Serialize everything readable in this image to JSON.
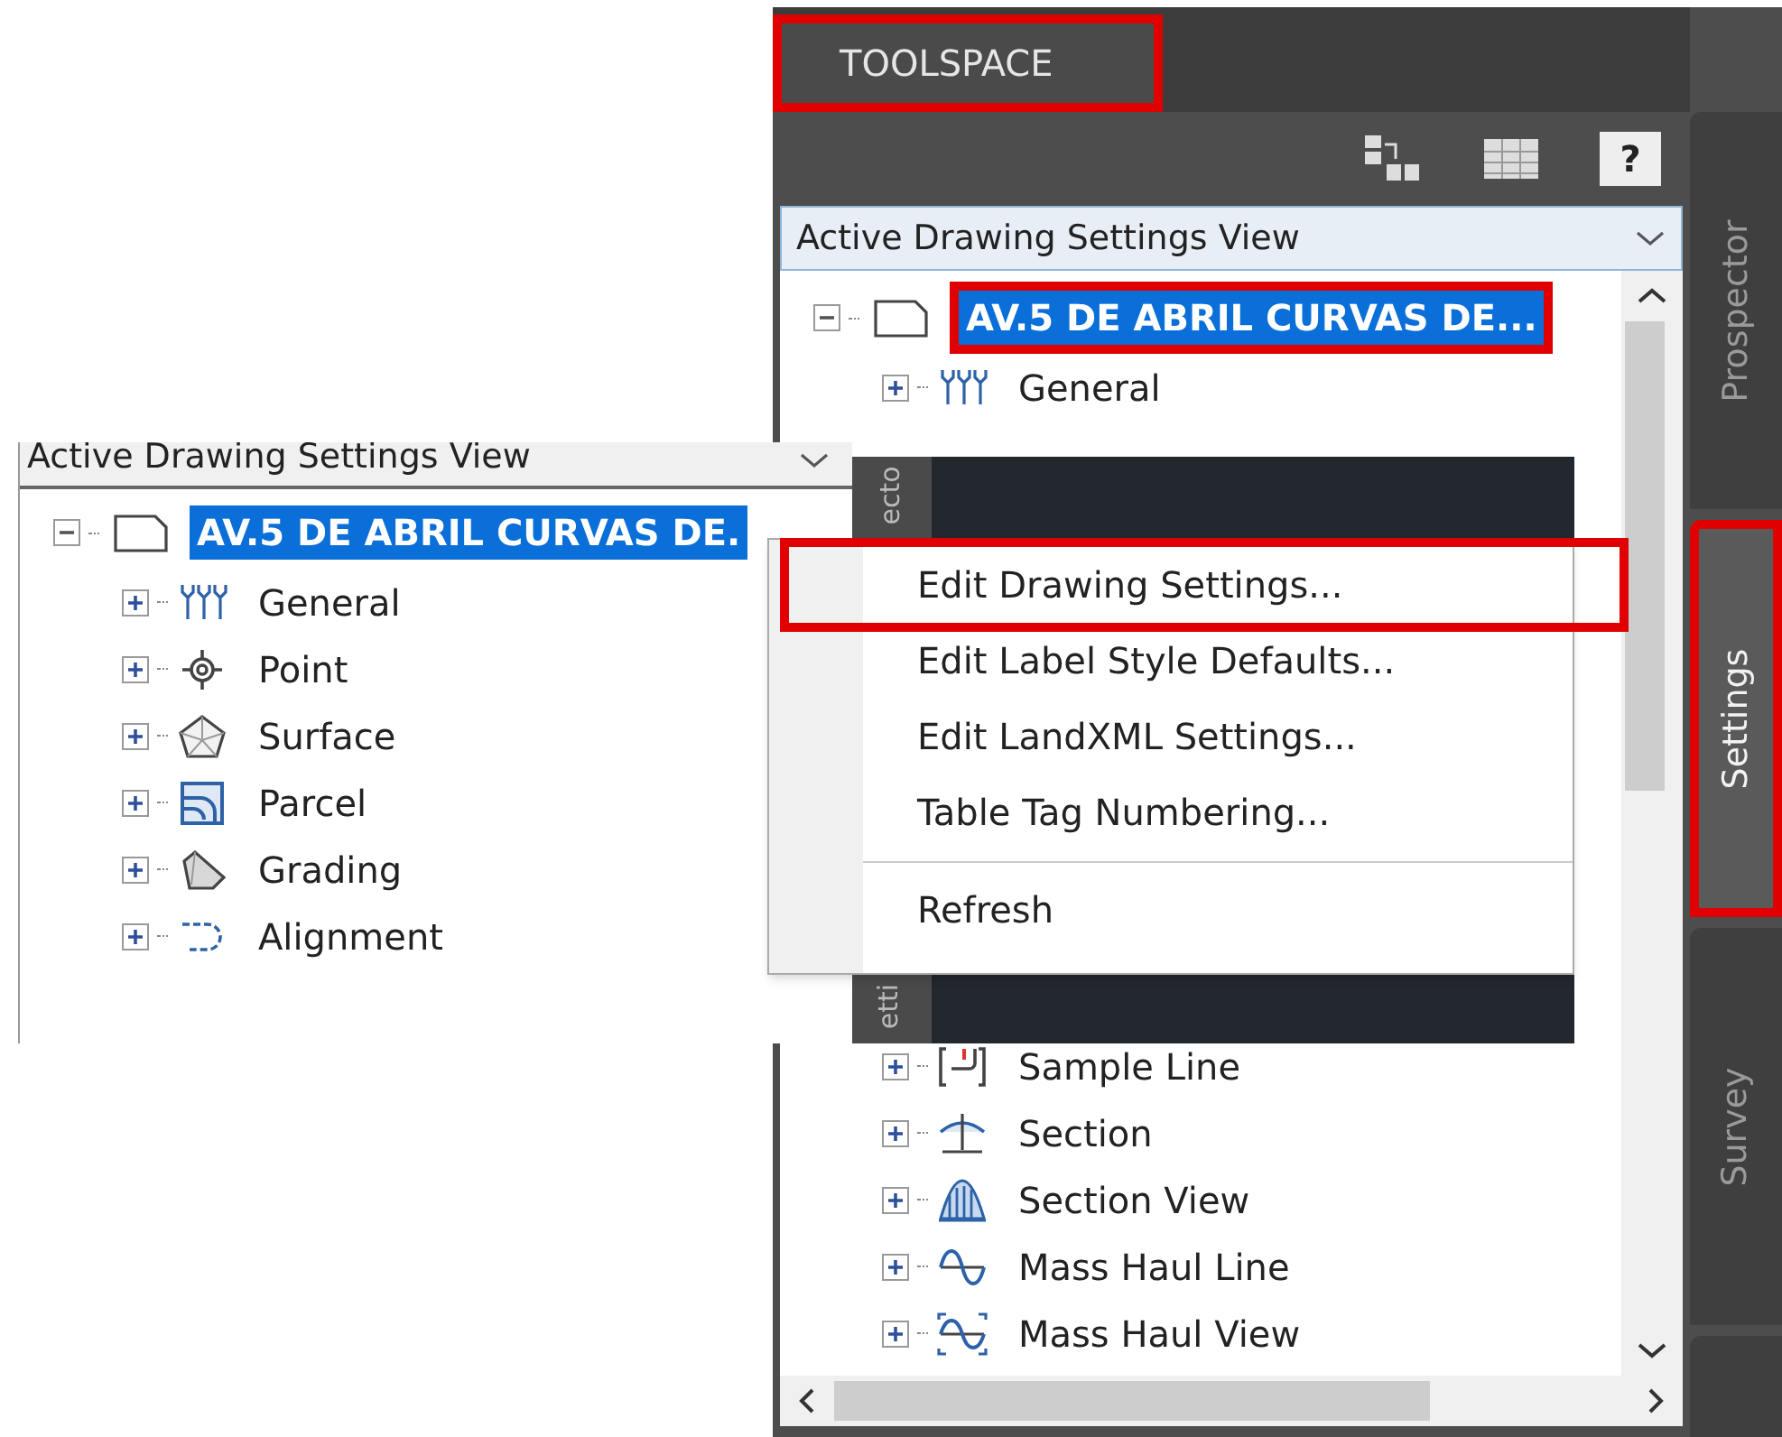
{
  "toolspace": {
    "title": "TOOLSPACE",
    "title_highlighted": true,
    "help": "?",
    "view": "Active Drawing Settings View",
    "tree": [
      {
        "label": "AV.5 DE ABRIL CURVAS DE...",
        "kind": "drawing",
        "selected": true,
        "highlighted": true,
        "expanded": true,
        "children": [
          {
            "label": "General",
            "kind": "general",
            "selected": false,
            "expanded": false
          },
          {
            "label": "Sample Line",
            "kind": "sample-line",
            "selected": false,
            "expanded": false,
            "gap_before": true
          },
          {
            "label": "Section",
            "kind": "section",
            "selected": false,
            "expanded": false
          },
          {
            "label": "Section View",
            "kind": "section-view",
            "selected": false,
            "expanded": false
          },
          {
            "label": "Mass Haul Line",
            "kind": "mass-haul-line",
            "selected": false,
            "expanded": false
          },
          {
            "label": "Mass Haul View",
            "kind": "mass-haul-view",
            "selected": false,
            "expanded": false
          }
        ]
      }
    ],
    "side_tabs": [
      {
        "label": "Prospector",
        "selected": false,
        "highlighted": false
      },
      {
        "label": "Settings",
        "selected": true,
        "highlighted": true
      },
      {
        "label": "Survey",
        "selected": false,
        "highlighted": false
      }
    ]
  },
  "inset": {
    "view": "Active Drawing Settings View",
    "tree": [
      {
        "label": "AV.5 DE ABRIL CURVAS DE.",
        "kind": "drawing",
        "selected": true,
        "expanded": true,
        "children": [
          {
            "label": "General",
            "kind": "general",
            "selected": false,
            "expanded": false
          },
          {
            "label": "Point",
            "kind": "point",
            "selected": false,
            "expanded": false
          },
          {
            "label": "Surface",
            "kind": "surface",
            "selected": false,
            "expanded": false
          },
          {
            "label": "Parcel",
            "kind": "parcel",
            "selected": false,
            "expanded": false
          },
          {
            "label": "Grading",
            "kind": "grading",
            "selected": false,
            "expanded": false
          },
          {
            "label": "Alignment",
            "kind": "alignment",
            "selected": false,
            "expanded": false
          }
        ]
      }
    ]
  },
  "behind_panel": {
    "tab_texts": [
      "ecto",
      "etti"
    ]
  },
  "context_menu": {
    "items": [
      {
        "kind": "item",
        "label": "Edit Drawing Settings...",
        "highlighted": true
      },
      {
        "kind": "item",
        "label": "Edit Label Style Defaults...",
        "highlighted": false
      },
      {
        "kind": "item",
        "label": "Edit LandXML Settings...",
        "highlighted": false
      },
      {
        "kind": "item",
        "label": "Table Tag Numbering...",
        "highlighted": false
      },
      {
        "kind": "separator"
      },
      {
        "kind": "item",
        "label": "Refresh",
        "highlighted": false
      }
    ]
  }
}
